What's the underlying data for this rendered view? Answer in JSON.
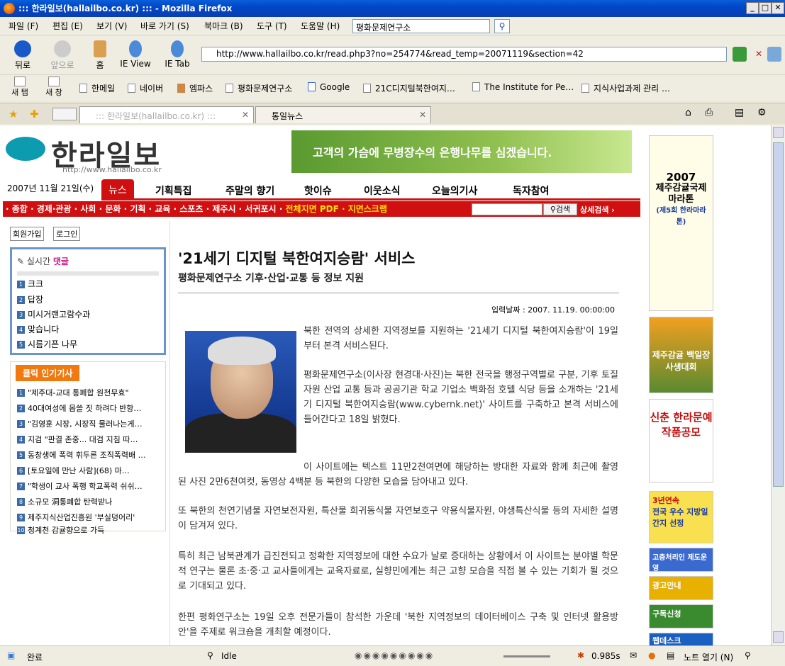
{
  "window": {
    "title": "::: 한라일보(hallailbo.co.kr) ::: - Mozilla Firefox"
  },
  "menu": [
    "파일 (F)",
    "편집 (E)",
    "보기 (V)",
    "바로 가기 (S)",
    "북마크 (B)",
    "도구 (T)",
    "도움말 (H)"
  ],
  "search": {
    "value": "평화문제연구소"
  },
  "nav": {
    "back": "뒤로",
    "forward": "앞으로",
    "home": "홈",
    "ieview": "IE View",
    "ietab": "IE Tab"
  },
  "url": "http://www.hallailbo.co.kr/read.php3?no=254774&read_temp=20071119&section=42",
  "bookmarks": {
    "newtab": "새 탭",
    "newwin": "새 창",
    "items": [
      "한메일",
      "네이버",
      "엠파스",
      "평화문제연구소",
      "Google",
      "21C디지털북한여지…",
      "The Institute for Pe…",
      "지식사업과제 관리 …"
    ]
  },
  "tabs": [
    "::: 한라일보(hallailbo.co.kr) :::",
    "통일뉴스"
  ],
  "site": {
    "logo": "한라일보",
    "logo_url": "http://www.hallailbo.co.kr",
    "banner": "고객의 가슴에 무병장수의 은행나무를 심겠습니다."
  },
  "date": "2007년 11월 21일(수)",
  "navtabs": [
    "뉴스",
    "기획특집",
    "주말의 향기",
    "핫이슈",
    "이웃소식",
    "오늘의기사",
    "독자참여"
  ],
  "sections": "· 종합 · 경제·관광 · 사회 · 문화 · 기획 · 교육 · 스포츠 · 제주시 · 서귀포시 · ",
  "sections_y": "전체지면 PDF · 지면스크랩",
  "site_search": {
    "button": "검색",
    "detail": "상세검색 ›"
  },
  "member": {
    "join": "회원가입",
    "login": "로그인"
  },
  "replies": {
    "title_a": "실시간",
    "title_b": "댓글",
    "items": [
      "크크",
      "답장",
      "미시거랜고람수과",
      "맞습니다",
      "시름기픈 나무"
    ]
  },
  "popular": {
    "title": "클릭 인기기사",
    "items": [
      "\"제주대-교대 통폐합 원천무효\"",
      "40대여성에 몹쓸 짓 하려다 반항…",
      "\"김영훈 시장, 시장직 물러나는게…",
      "지검 \"판결 존중... 대검 지침 따…",
      "동창생에 폭력 휘두른 조직폭력배 …",
      "[토요일에 만난 사람](68) 마…",
      "\"학생이 교사 폭행 학교폭력 쉬쉬…",
      "소규모 洞통폐합 탄력받나",
      "제주지식산업진흥원 '부실덩어리'",
      "청계천 감귤향으로 가득"
    ]
  },
  "article": {
    "headline": "'21세기 디지털 북한여지승람' 서비스",
    "subhead": "평화문제연구소 기후·산업·교통 등 정보 지원",
    "date": "입력날짜 : 2007. 11.19. 00:00:00",
    "p1": "북한 전역의 상세한 지역정보를 지원하는 '21세기 디지털 북한여지승람'이 19일부터 본격 서비스된다.",
    "p2": "평화문제연구소(이사장 현경대·사진)는 북한 전국을 행정구역별로 구분, 기후 토질 자원 산업 교통 등과 공공기관 학교 기업소 백화점 호텔 식당 등을 소개하는 '21세기 디지털 북한여지승람(www.cybernk.net)' 사이트를 구축하고 본격 서비스에 들어간다고 18일 밝혔다.",
    "p3": "이 사이트에는 텍스트 11만2천여면에 해당하는 방대한 자료와 함께 최근에 촬영된 사진 2만6천여컷, 동영상 4백분 등 북한의 다양한 모습을 담아내고 있다.",
    "p4": "또 북한의 천연기념물 자연보전자원, 특산물 희귀동식물 자연보호구 약용식물자원, 야생특산식물 등의 자세한 설명이 담겨져 있다.",
    "p5": "특히 최근 남북관계가 급진전되고 정확한 지역정보에 대한 수요가 날로 증대하는 상황에서 이 사이트는 분야별 학문적 연구는 물론 초·중·고 교사들에게는 교육자료로, 실향민에게는 최근 고향 모습을 직접 볼 수 있는 기회가 될 것으로 기대되고 있다.",
    "p6": "한편 평화연구소는 19일 오후 전문가들이 참석한 가운데 '북한 지역정보의 데이터베이스 구축 및 인터넷 활용방안'을 주제로 워크숍을 개최할 예정이다."
  },
  "ads": {
    "marathon_year": "2007",
    "marathon_title": "제주감귤국제마라톤",
    "marathon_sub": "(제5회 한라마라톤)",
    "ad2": "제주감귤 백일장 사생대회",
    "ad3": "신춘 한라문예 작품공모",
    "ad4a": "3년연속",
    "ad4b": "전국 우수 지방일간지 선정",
    "ad5": "고충처리인 제도운영",
    "ad6": "광고안내",
    "ad7": "구독신청",
    "ad8": "웹데스크"
  },
  "status": {
    "left": "완료",
    "idle": "Idle",
    "time": "0.985s",
    "notes": "노트 열기 (N)"
  }
}
